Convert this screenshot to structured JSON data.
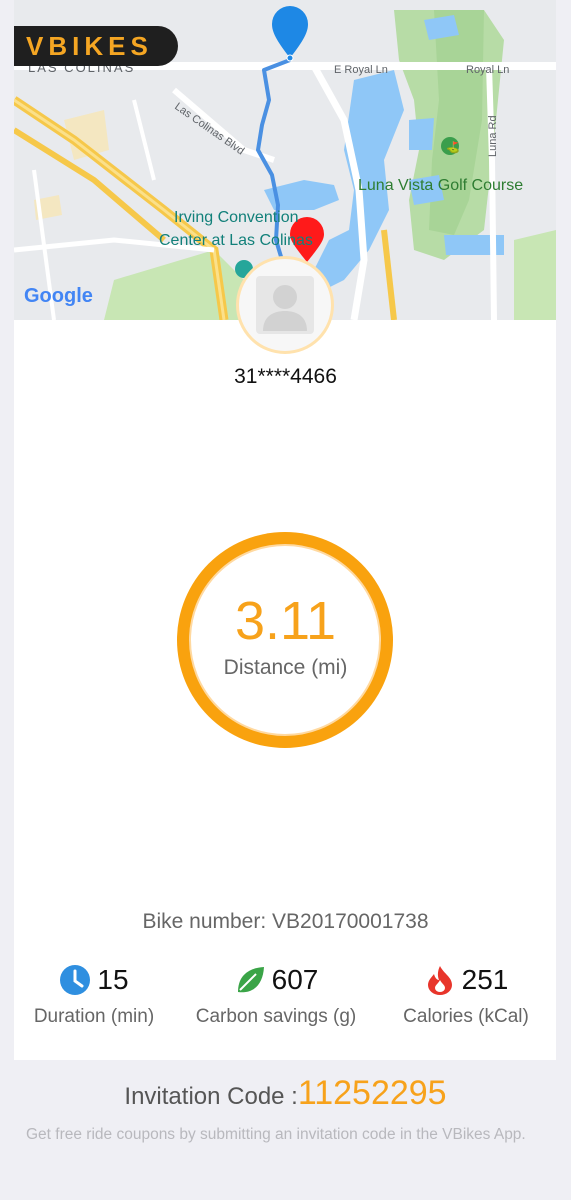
{
  "brand": {
    "logo_text": "VBIKES",
    "accent": "#F7A21B"
  },
  "map": {
    "labels": {
      "las_colinas": "LAS COLINAS",
      "royal_ln_east": "E Royal Ln",
      "royal_ln": "Royal Ln",
      "las_colinas_blvd": "Las Colinas Blvd",
      "luna_rd": "Luna Rd",
      "golf_course": "Luna Vista Golf Course",
      "convention_line1": "Irving Convention",
      "convention_line2": "Center at Las Colinas",
      "google": "Google"
    },
    "start_pin_color": "#1E88E5",
    "end_pin_color": "#FF1A1A",
    "route_color": "#4A90E2"
  },
  "user": {
    "phone_masked": "31****4466"
  },
  "ride": {
    "distance_value": "3.11",
    "distance_label": "Distance (mi)",
    "bike_number_text": "Bike number: VB20170001738"
  },
  "stats": [
    {
      "icon": "clock-icon",
      "value": "15",
      "label": "Duration (min)"
    },
    {
      "icon": "leaf-icon",
      "value": "607",
      "label": "Carbon savings (g)"
    },
    {
      "icon": "flame-icon",
      "value": "251",
      "label": "Calories (kCal)"
    }
  ],
  "invitation": {
    "label": "Invitation Code :",
    "code": "11252295",
    "note": "Get free ride coupons by submitting an invitation code in the VBikes App."
  }
}
